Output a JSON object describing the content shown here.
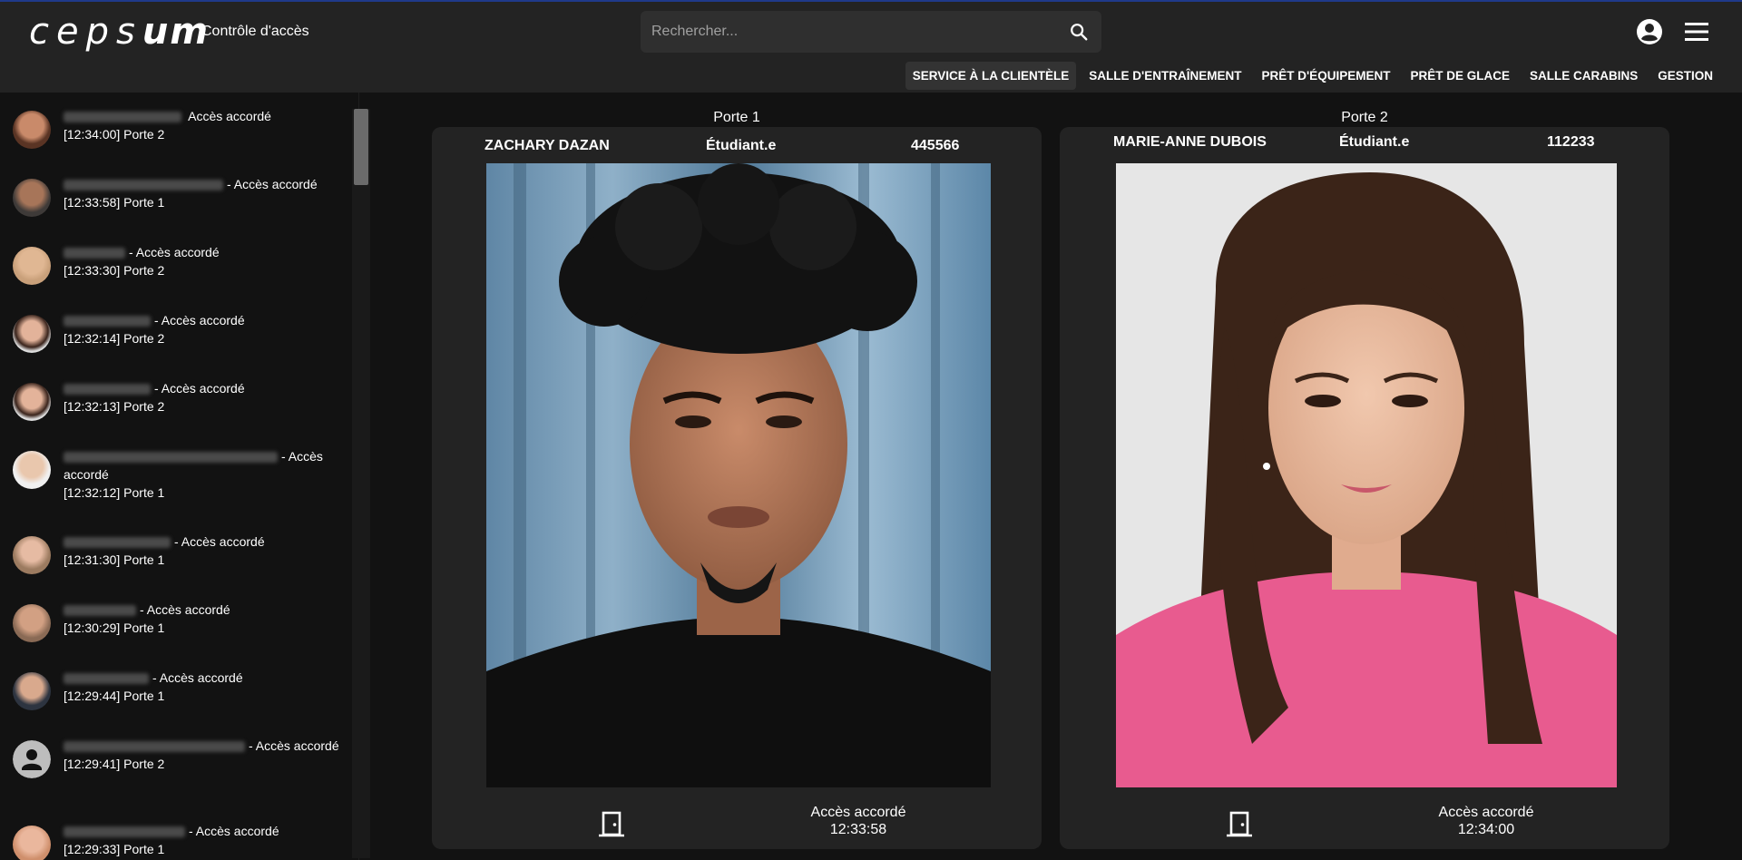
{
  "app": {
    "logo_light": "ceps",
    "logo_bold": "um",
    "subtitle": "Contrôle d'accès"
  },
  "search": {
    "placeholder": "Rechercher..."
  },
  "nav": {
    "items": [
      "SERVICE À LA CLIENTÈLE",
      "SALLE D'ENTRAÎNEMENT",
      "PRÊT D'ÉQUIPEMENT",
      "PRÊT DE GLACE",
      "SALLE CARABINS",
      "GESTION"
    ],
    "active_index": 0
  },
  "log": [
    {
      "status": "Accès accordé",
      "detail": "[12:34:00] Porte 2"
    },
    {
      "status": "- Accès accordé",
      "detail": "[12:33:58] Porte 1"
    },
    {
      "status": "- Accès accordé",
      "detail": "[12:33:30] Porte 2"
    },
    {
      "status": "- Accès accordé",
      "detail": "[12:32:14] Porte 2"
    },
    {
      "status": "- Accès accordé",
      "detail": "[12:32:13] Porte 2"
    },
    {
      "status": "- Accès accordé",
      "detail": "[12:32:12] Porte 1"
    },
    {
      "status": "- Accès accordé",
      "detail": "[12:31:30] Porte 1"
    },
    {
      "status": "- Accès accordé",
      "detail": "[12:30:29] Porte 1"
    },
    {
      "status": "- Accès accordé",
      "detail": "[12:29:44] Porte 1"
    },
    {
      "status": "- Accès accordé",
      "detail": "[12:29:41] Porte 2"
    },
    {
      "status": "- Accès accordé",
      "detail": "[12:29:33] Porte 1"
    }
  ],
  "doors": [
    {
      "label": "Porte 1",
      "name": "ZACHARY DAZAN",
      "role": "Étudiant.e",
      "id": "445566",
      "status": "Accès accordé",
      "time": "12:33:58"
    },
    {
      "label": "Porte 2",
      "name": "MARIE-ANNE DUBOIS",
      "role": "Étudiant.e",
      "id": "112233",
      "status": "Accès accordé",
      "time": "12:34:00"
    }
  ],
  "colors": {
    "background": "#121212",
    "panel": "#232323",
    "accent_border": "#1f3a8a"
  }
}
